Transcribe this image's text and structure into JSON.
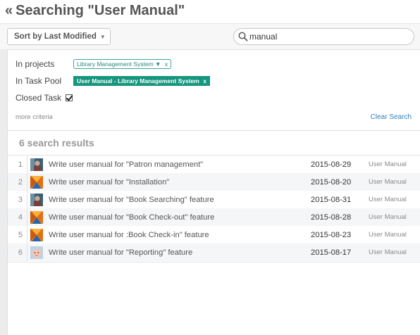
{
  "header": {
    "back_glyph": "«",
    "title": "Searching \"User Manual\""
  },
  "toolbar": {
    "sort_label": "Sort by Last Modified",
    "caret_glyph": "▼",
    "search_value": "manual",
    "search_icon": "search-icon"
  },
  "criteria": {
    "projects_label": "In projects",
    "projects_tag": "Library Management System",
    "projects_tag_caret": "▼",
    "projects_tag_remove": "x",
    "pool_label": "In Task Pool",
    "pool_tag": "User Manual - Library Management System",
    "pool_tag_remove": "x",
    "closed_label": "Closed Task",
    "closed_checked": true,
    "more_label": "more criteria",
    "clear_label": "Clear Search"
  },
  "results": {
    "count_label": "6 search results",
    "rows": [
      {
        "num": "1",
        "title": "Write user manual for \"Patron management\"",
        "date": "2015-08-29",
        "pool": "User Manual",
        "thumb": "portrait-thumb"
      },
      {
        "num": "2",
        "title": "Write user manual for \"Installation\"",
        "date": "2015-08-20",
        "pool": "User Manual",
        "thumb": "orange-avatar-thumb"
      },
      {
        "num": "3",
        "title": "Write user manual for \"Book Searching\" feature",
        "date": "2015-08-31",
        "pool": "User Manual",
        "thumb": "portrait-thumb"
      },
      {
        "num": "4",
        "title": "Write user manual for \"Book Check-out\" feature",
        "date": "2015-08-28",
        "pool": "User Manual",
        "thumb": "orange-avatar-thumb"
      },
      {
        "num": "5",
        "title": "Write user manual for :Book Check-in\" feature",
        "date": "2015-08-23",
        "pool": "User Manual",
        "thumb": "orange-avatar-thumb"
      },
      {
        "num": "6",
        "title": "Write user manual for \"Reporting\" feature",
        "date": "2015-08-17",
        "pool": "User Manual",
        "thumb": "baby-face-thumb"
      }
    ]
  },
  "colors": {
    "accent_teal": "#16967f",
    "link_blue": "#2f7fc0",
    "alt_row": "#f4f6f7"
  }
}
